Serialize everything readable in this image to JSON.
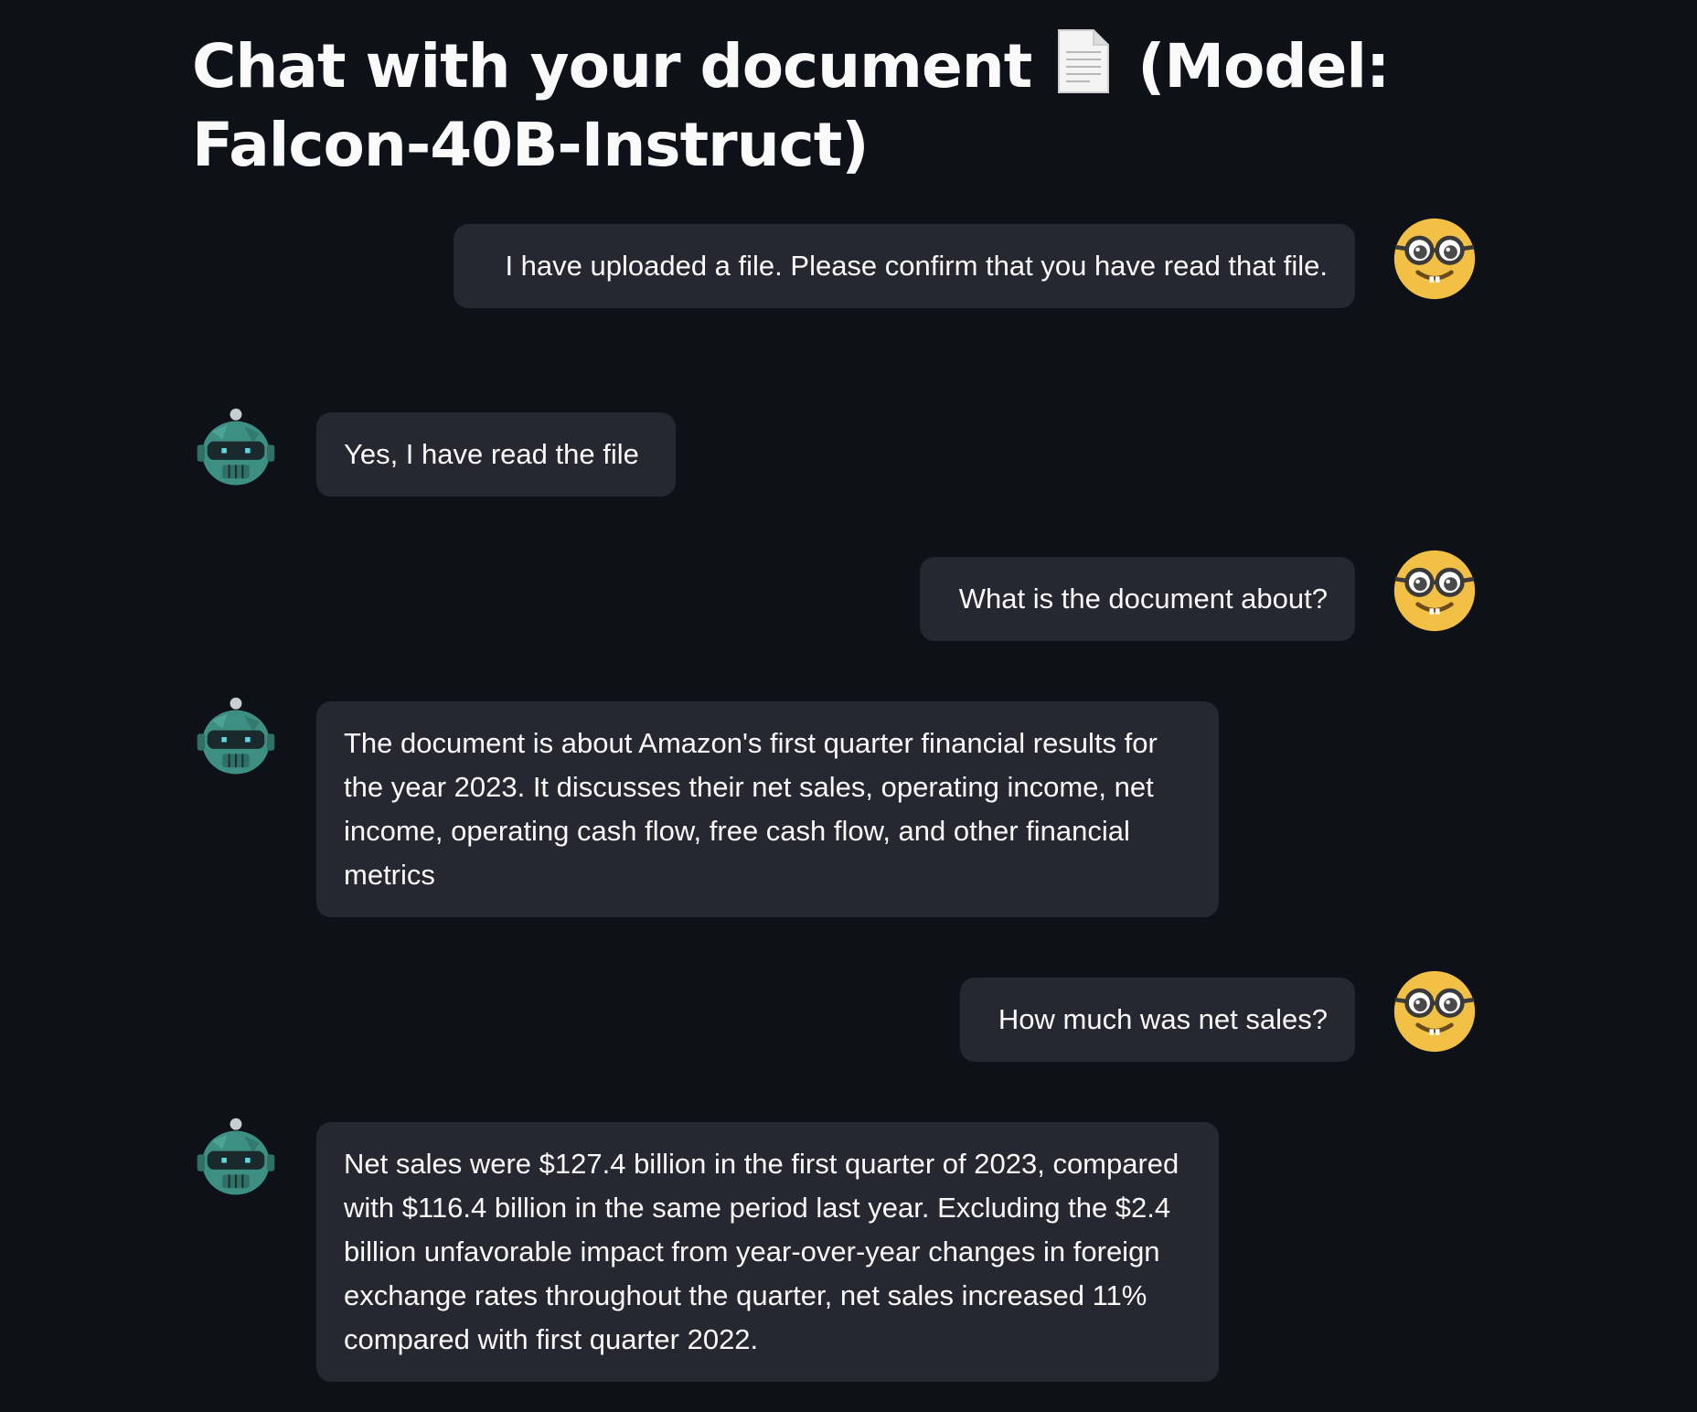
{
  "header": {
    "title_prefix": "Chat with your document",
    "title_suffix": "(Model: Falcon-40B-Instruct)",
    "title_icon": "page-facing-up-emoji"
  },
  "avatars": {
    "user": "nerd-face-emoji",
    "assistant": "robot-avatar"
  },
  "colors": {
    "background": "#0e1117",
    "bubble": "#262730",
    "text": "#fafafa",
    "user_avatar": "#f1c045",
    "bot_avatar": "#3d8f83"
  },
  "messages": [
    {
      "role": "user",
      "text": "I have uploaded a file. Please confirm that you have read that file."
    },
    {
      "role": "assistant",
      "text": "Yes, I have read the file"
    },
    {
      "role": "user",
      "text": "What is the document about?"
    },
    {
      "role": "assistant",
      "text": "The document is about Amazon's first quarter financial results for the year 2023. It discusses their net sales, operating income, net income, operating cash flow, free cash flow, and other financial metrics"
    },
    {
      "role": "user",
      "text": "How much was net sales?"
    },
    {
      "role": "assistant",
      "text": "Net sales were $127.4 billion in the first quarter of 2023, compared with $116.4 billion in the same period last year. Excluding the $2.4 billion unfavorable impact from year-over-year changes in foreign exchange rates throughout the quarter, net sales increased 11% compared with first quarter 2022."
    }
  ]
}
